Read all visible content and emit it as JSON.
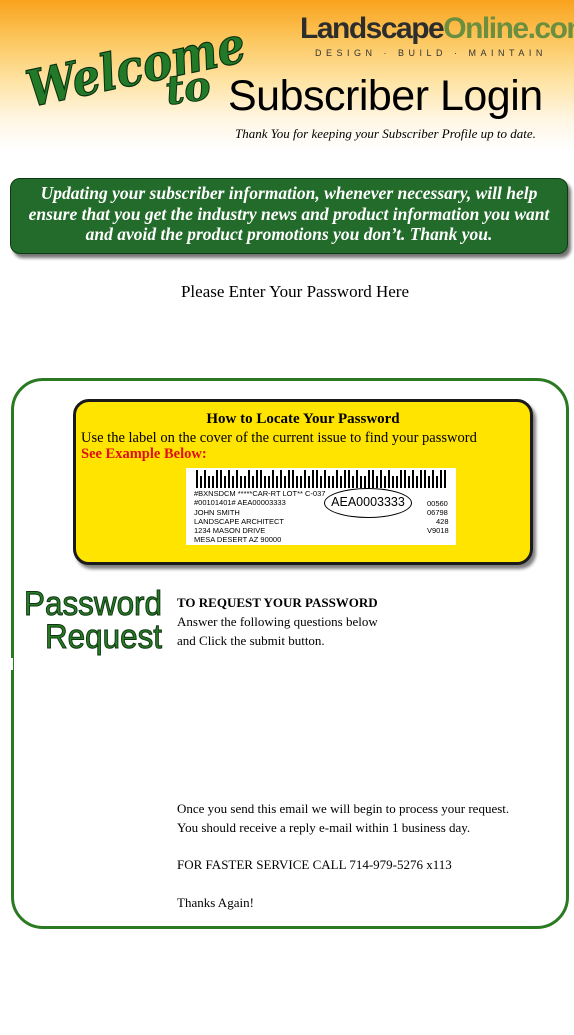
{
  "header": {
    "welcome_line1": "Welcome",
    "welcome_line2": "to",
    "logo_part1": "Landscape",
    "logo_part2": "Online.com",
    "logo_tagline": "DESIGN · BUILD · MAINTAIN",
    "title": "Subscriber Login",
    "thanks_note": "Thank You for keeping your Subscriber Profile up to date."
  },
  "banner": {
    "text": "Updating your subscriber information, whenever necessary, will help ensure that you get the industry news and product information you want and avoid the product promotions you don’t.  Thank you."
  },
  "prompt": "Please Enter Your Password Here",
  "locate_box": {
    "title": "How to Locate Your Password",
    "instruction": "Use the label on the cover of the current issue to find your password",
    "example_label": "See Example Below:",
    "label_lines": {
      "line1": "#BXNSDCM  *****CAR-RT LOT** C-037",
      "line2": "#00101401#  AEA00003333",
      "line3": "JOHN SMITH",
      "line4": "LANDSCAPE ARCHITECT",
      "line5": "1234 MASON DRIVE",
      "line6": "MESA DESERT    AZ    90000",
      "right1": "00560",
      "right2": "06798",
      "right3": "428",
      "right4": "V9018"
    },
    "password_example": "AEA0003333"
  },
  "request": {
    "heading_line1": "Password",
    "heading_line2": "Request",
    "subheading": "TO REQUEST YOUR PASSWORD",
    "instruction_line1": "Answer the following questions below",
    "instruction_line2": "and Click the submit button.",
    "process_line1": "Once you send this email we will begin to process your request.",
    "process_line2": "You should receive a reply e-mail within 1 business day.",
    "phone": "FOR FASTER SERVICE CALL 714-979-5276 x113",
    "signoff": "Thanks Again!"
  },
  "colors": {
    "brand_green": "#236b2a",
    "panel_border": "#2a7a22",
    "header_orange": "#f9a21c",
    "info_yellow": "#ffe400",
    "example_red": "#e01010",
    "logo_green": "#6b8f3e"
  }
}
